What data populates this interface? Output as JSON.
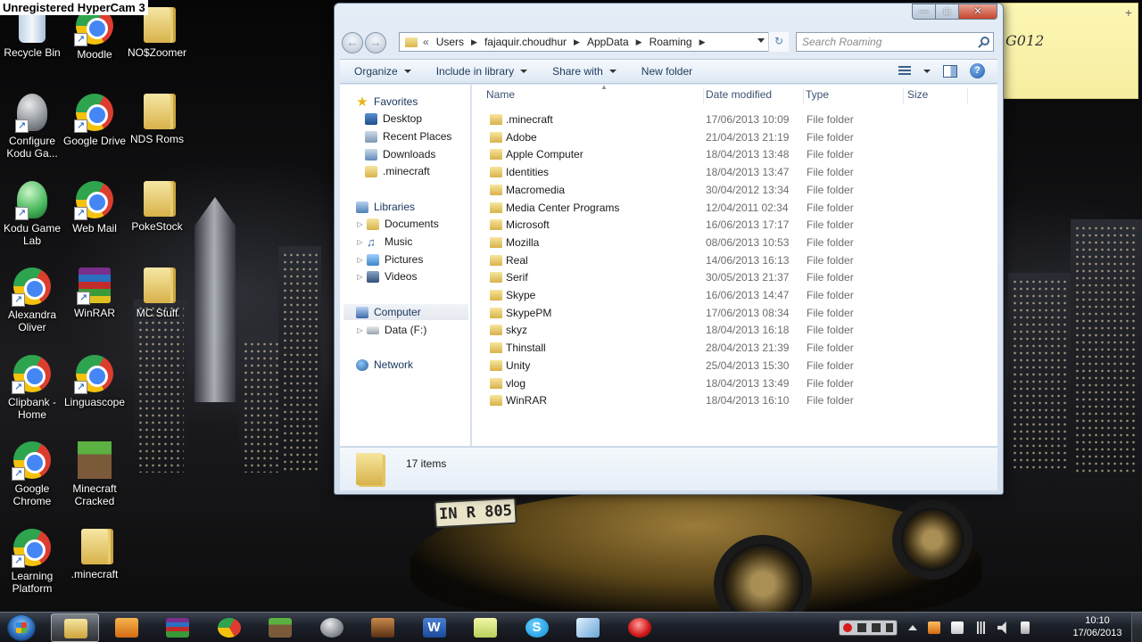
{
  "hypercam_banner": "Unregistered HyperCam 3",
  "desktop": {
    "icons": [
      {
        "label": "Recycle Bin",
        "icon": "recycle-bin-icon"
      },
      {
        "label": "Moodle",
        "icon": "chrome-icon"
      },
      {
        "label": "NO$Zoomer",
        "icon": "folder-icon"
      },
      {
        "label": "Configure Kodu Ga...",
        "icon": "kodu-config-icon"
      },
      {
        "label": "Google Drive",
        "icon": "chrome-icon"
      },
      {
        "label": "NDS Roms",
        "icon": "folder-icon"
      },
      {
        "label": "Kodu Game Lab",
        "icon": "kodu-icon"
      },
      {
        "label": "Web Mail",
        "icon": "chrome-icon"
      },
      {
        "label": "PokeStock",
        "icon": "folder-icon"
      },
      {
        "label": "Alexandra Oliver",
        "icon": "chrome-icon"
      },
      {
        "label": "WinRAR",
        "icon": "winrar-icon"
      },
      {
        "label": "MC Stuff",
        "icon": "folder-icon"
      },
      {
        "label": "Clipbank - Home",
        "icon": "chrome-icon"
      },
      {
        "label": "Linguascope",
        "icon": "chrome-icon"
      },
      {
        "label": "Google Chrome",
        "icon": "chrome-icon"
      },
      {
        "label": "Minecraft Cracked",
        "icon": "minecraft-icon"
      },
      {
        "label": "Learning Platform",
        "icon": "chrome-icon"
      },
      {
        "label": ".minecraft",
        "icon": "folder-icon"
      }
    ],
    "license_plate": "IN R 805",
    "sticky_note_text": "G012"
  },
  "explorer": {
    "breadcrumb": [
      "Users",
      "fajaquir.choudhur",
      "AppData",
      "Roaming"
    ],
    "breadcrumb_overflow": "«",
    "search_placeholder": "Search Roaming",
    "toolbar": {
      "organize": "Organize",
      "include_in_library": "Include in library",
      "share_with": "Share with",
      "new_folder": "New folder"
    },
    "nav": {
      "favorites": "Favorites",
      "favorites_items": [
        "Desktop",
        "Recent Places",
        "Downloads",
        ".minecraft"
      ],
      "libraries": "Libraries",
      "libraries_items": [
        "Documents",
        "Music",
        "Pictures",
        "Videos"
      ],
      "computer": "Computer",
      "computer_items": [
        "Data (F:)"
      ],
      "network": "Network"
    },
    "columns": {
      "name": "Name",
      "date": "Date modified",
      "type": "Type",
      "size": "Size"
    },
    "files": [
      {
        "name": ".minecraft",
        "date": "17/06/2013 10:09",
        "type": "File folder"
      },
      {
        "name": "Adobe",
        "date": "21/04/2013 21:19",
        "type": "File folder"
      },
      {
        "name": "Apple Computer",
        "date": "18/04/2013 13:48",
        "type": "File folder"
      },
      {
        "name": "Identities",
        "date": "18/04/2013 13:47",
        "type": "File folder"
      },
      {
        "name": "Macromedia",
        "date": "30/04/2012 13:34",
        "type": "File folder"
      },
      {
        "name": "Media Center Programs",
        "date": "12/04/2011 02:34",
        "type": "File folder"
      },
      {
        "name": "Microsoft",
        "date": "16/06/2013 17:17",
        "type": "File folder"
      },
      {
        "name": "Mozilla",
        "date": "08/06/2013 10:53",
        "type": "File folder"
      },
      {
        "name": "Real",
        "date": "14/06/2013 16:13",
        "type": "File folder"
      },
      {
        "name": "Serif",
        "date": "30/05/2013 21:37",
        "type": "File folder"
      },
      {
        "name": "Skype",
        "date": "16/06/2013 14:47",
        "type": "File folder"
      },
      {
        "name": "SkypePM",
        "date": "17/06/2013 08:34",
        "type": "File folder"
      },
      {
        "name": "skyz",
        "date": "18/04/2013 16:18",
        "type": "File folder"
      },
      {
        "name": "Thinstall",
        "date": "28/04/2013 21:39",
        "type": "File folder"
      },
      {
        "name": "Unity",
        "date": "25/04/2013 15:30",
        "type": "File folder"
      },
      {
        "name": "vlog",
        "date": "18/04/2013 13:49",
        "type": "File folder"
      },
      {
        "name": "WinRAR",
        "date": "18/04/2013 16:10",
        "type": "File folder"
      }
    ],
    "item_count": "17 items"
  },
  "taskbar": {
    "apps": [
      {
        "icon": "explorer-icon",
        "active": true
      },
      {
        "icon": "media-player-icon",
        "active": false
      },
      {
        "icon": "winrar-icon",
        "active": false
      },
      {
        "icon": "chrome-icon",
        "active": false
      },
      {
        "icon": "minecraft-icon",
        "active": false
      },
      {
        "icon": "kodu-icon",
        "active": false
      },
      {
        "icon": "game-character-icon",
        "active": false
      },
      {
        "icon": "word-icon",
        "active": false,
        "letter": "W"
      },
      {
        "icon": "sticky-notes-icon",
        "active": false
      },
      {
        "icon": "skype-icon",
        "active": false,
        "letter": "S"
      },
      {
        "icon": "snipping-tool-icon",
        "active": false
      },
      {
        "icon": "recording-icon",
        "active": false
      }
    ],
    "clock": {
      "time": "10:10",
      "date": "17/06/2013"
    }
  }
}
